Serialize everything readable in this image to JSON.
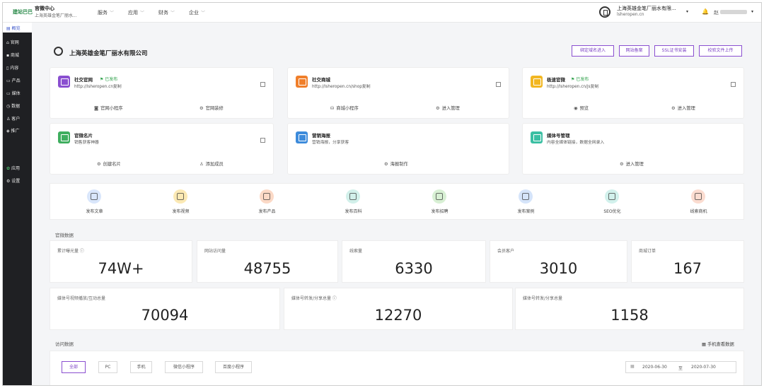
{
  "topbar": {
    "logo": "建站巴巴",
    "brand_title": "官微中心",
    "brand_sub": "上海英雄金笔厂丽水...",
    "nav": [
      "服务",
      "应用",
      "财务",
      "企业"
    ],
    "site_name": "上海英雄金笔厂丽水有限...",
    "site_domain": "lsheropen.cn",
    "user_name": "赵"
  },
  "sidebar": {
    "items": [
      "概览",
      "官网",
      "商城",
      "内容",
      "产品",
      "媒体",
      "数据",
      "客户",
      "推广",
      "应用",
      "设置"
    ]
  },
  "header": {
    "company": "上海英雄金笔厂丽水有限公司",
    "buttons": [
      "绑定域名进入",
      "网站备案",
      "SSL证书安装",
      "校验文件上传"
    ]
  },
  "cards": [
    {
      "title": "社交官网",
      "badge": "已发布",
      "sub": "http://lsheropen.cn复制",
      "color": "#8a4fd0",
      "actions": [
        "官网小程序",
        "官网装修"
      ]
    },
    {
      "title": "社交商城",
      "badge": "",
      "sub": "http://lsheropen.cn/shop复制",
      "color": "#f07f2b",
      "actions": [
        "商城小程序",
        "进入管理"
      ]
    },
    {
      "title": "极速官微",
      "badge": "已发布",
      "sub": "http://lsheropen.cn/js复制",
      "color": "#f2b722",
      "actions": [
        "预览",
        "进入管理"
      ]
    },
    {
      "title": "官微名片",
      "badge": "",
      "sub": "销售获客神器",
      "color": "#3fae5f",
      "actions": [
        "创建名片",
        "添加成员"
      ]
    },
    {
      "title": "营销海报",
      "badge": "",
      "sub": "营销海报，分享获客",
      "color": "#3d8bdb",
      "actions": [
        "海报制作"
      ]
    },
    {
      "title": "媒体号管理",
      "badge": "",
      "sub": "内容全媒体链接，数据全网录入",
      "color": "#3bbfa3",
      "actions": [
        "进入管理"
      ]
    }
  ],
  "quick_actions": [
    {
      "label": "发布文章",
      "color": "#d9e6fb"
    },
    {
      "label": "发布视频",
      "color": "#fbe9b4"
    },
    {
      "label": "发布产品",
      "color": "#fbd9c6"
    },
    {
      "label": "发布百科",
      "color": "#d2f0ea"
    },
    {
      "label": "发布招聘",
      "color": "#d8f0d4"
    },
    {
      "label": "发布案例",
      "color": "#d5e4fa"
    },
    {
      "label": "SEO优化",
      "color": "#d2f1ec"
    },
    {
      "label": "线索商机",
      "color": "#fbdcd0"
    }
  ],
  "site_data": {
    "title": "官微数据",
    "row1": [
      {
        "label": "累计曝光量 ⓘ",
        "value": "74W+"
      },
      {
        "label": "网站访问量",
        "value": "48755"
      },
      {
        "label": "线索量",
        "value": "6330"
      },
      {
        "label": "会员客户",
        "value": "3010"
      },
      {
        "label": "商城订单",
        "value": "167"
      }
    ],
    "row2": [
      {
        "label": "媒体号视频播放/互动总量",
        "value": "70094"
      },
      {
        "label": "媒体号转发/分享总量 ⓘ",
        "value": "12270"
      },
      {
        "label": "媒体号转发/分享总量",
        "value": "1158"
      }
    ]
  },
  "visit_data": {
    "title": "访问数据",
    "mobile_link": "手机查看数据",
    "filters": [
      "全部",
      "PC",
      "手机",
      "微信小程序",
      "百度小程序"
    ],
    "date_from": "2020-06-30",
    "date_sep": "至",
    "date_to": "2020-07-30"
  }
}
